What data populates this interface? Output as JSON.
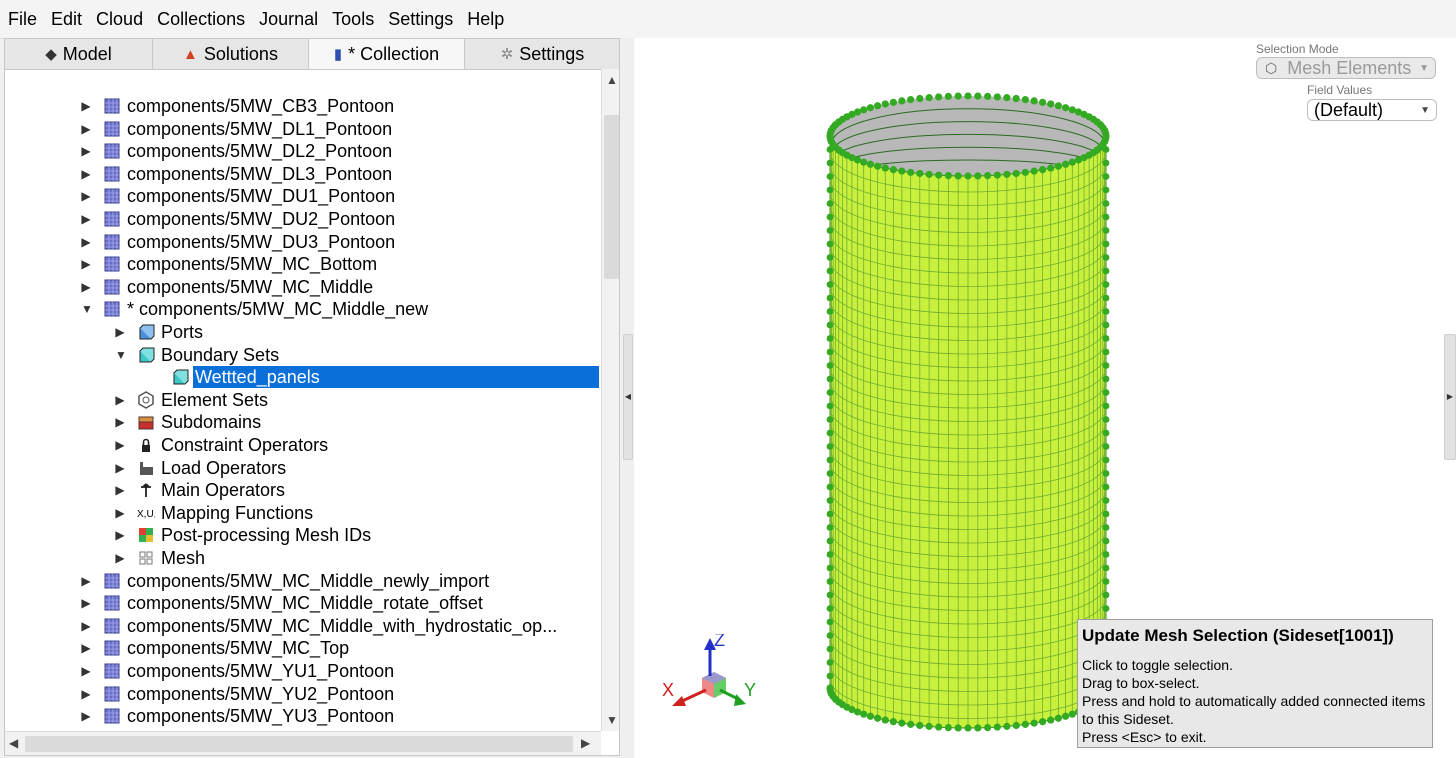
{
  "menu": [
    "File",
    "Edit",
    "Cloud",
    "Collections",
    "Journal",
    "Tools",
    "Settings",
    "Help"
  ],
  "tabs": [
    {
      "label": "Model",
      "icon": "model-icon"
    },
    {
      "label": "Solutions",
      "icon": "solutions-icon"
    },
    {
      "label": "* Collection",
      "icon": "collection-icon"
    },
    {
      "label": "Settings",
      "icon": "gear-icon"
    }
  ],
  "tree": [
    {
      "label": "components/5MW_CB3_Pontoon",
      "level": 0,
      "expanded": false,
      "icon": "component"
    },
    {
      "label": "components/5MW_DL1_Pontoon",
      "level": 0,
      "expanded": false,
      "icon": "component"
    },
    {
      "label": "components/5MW_DL2_Pontoon",
      "level": 0,
      "expanded": false,
      "icon": "component"
    },
    {
      "label": "components/5MW_DL3_Pontoon",
      "level": 0,
      "expanded": false,
      "icon": "component"
    },
    {
      "label": "components/5MW_DU1_Pontoon",
      "level": 0,
      "expanded": false,
      "icon": "component"
    },
    {
      "label": "components/5MW_DU2_Pontoon",
      "level": 0,
      "expanded": false,
      "icon": "component"
    },
    {
      "label": "components/5MW_DU3_Pontoon",
      "level": 0,
      "expanded": false,
      "icon": "component"
    },
    {
      "label": "components/5MW_MC_Bottom",
      "level": 0,
      "expanded": false,
      "icon": "component"
    },
    {
      "label": "components/5MW_MC_Middle",
      "level": 0,
      "expanded": false,
      "icon": "component"
    },
    {
      "label": "* components/5MW_MC_Middle_new",
      "level": 0,
      "expanded": true,
      "icon": "component"
    },
    {
      "label": "Ports",
      "level": 1,
      "expanded": false,
      "icon": "ports"
    },
    {
      "label": "Boundary Sets",
      "level": 1,
      "expanded": true,
      "icon": "boundary"
    },
    {
      "label": "Wettted_panels",
      "level": 2,
      "expanded": null,
      "icon": "boundary",
      "selected": true
    },
    {
      "label": "Element Sets",
      "level": 1,
      "expanded": false,
      "icon": "element-sets"
    },
    {
      "label": "Subdomains",
      "level": 1,
      "expanded": false,
      "icon": "subdomains"
    },
    {
      "label": "Constraint Operators",
      "level": 1,
      "expanded": false,
      "icon": "lock"
    },
    {
      "label": "Load Operators",
      "level": 1,
      "expanded": false,
      "icon": "load"
    },
    {
      "label": "Main Operators",
      "level": 1,
      "expanded": false,
      "icon": "main-op"
    },
    {
      "label": "Mapping Functions",
      "level": 1,
      "expanded": false,
      "icon": "mapping"
    },
    {
      "label": "Post-processing Mesh IDs",
      "level": 1,
      "expanded": false,
      "icon": "postproc"
    },
    {
      "label": "Mesh",
      "level": 1,
      "expanded": false,
      "icon": "mesh"
    },
    {
      "label": "components/5MW_MC_Middle_newly_import",
      "level": 0,
      "expanded": false,
      "icon": "component"
    },
    {
      "label": "components/5MW_MC_Middle_rotate_offset",
      "level": 0,
      "expanded": false,
      "icon": "component"
    },
    {
      "label": "components/5MW_MC_Middle_with_hydrostatic_op...",
      "level": 0,
      "expanded": false,
      "icon": "component"
    },
    {
      "label": "components/5MW_MC_Top",
      "level": 0,
      "expanded": false,
      "icon": "component"
    },
    {
      "label": "components/5MW_YU1_Pontoon",
      "level": 0,
      "expanded": false,
      "icon": "component"
    },
    {
      "label": "components/5MW_YU2_Pontoon",
      "level": 0,
      "expanded": false,
      "icon": "component"
    },
    {
      "label": "components/5MW_YU3_Pontoon",
      "level": 0,
      "expanded": false,
      "icon": "component"
    }
  ],
  "viewport": {
    "selection_mode_label": "Selection Mode",
    "selection_mode_value": "Mesh Elements",
    "field_values_label": "Field Values",
    "field_values_value": "(Default)",
    "axis_x": "X",
    "axis_y": "Y",
    "axis_z": "Z",
    "mesh_color": "#c8f03c",
    "node_color": "#33aa22"
  },
  "tooltip": {
    "title": "Update Mesh Selection (Sideset[1001])",
    "lines": [
      "Click to toggle selection.",
      "Drag to box-select.",
      "Press and hold to automatically added connected items to this Sideset.",
      "Press <Esc> to exit."
    ]
  }
}
